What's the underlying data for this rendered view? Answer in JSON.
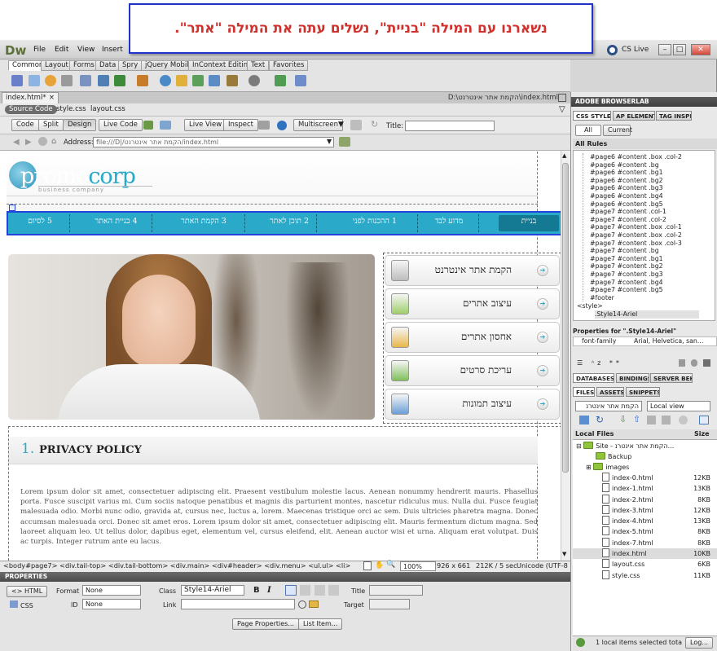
{
  "callout": {
    "text": "נשארנו עם המילה \"בניית\", נשלים עתה את המילה \"אתר\"."
  },
  "app": {
    "logo": "Dw",
    "menu": [
      "File",
      "Edit",
      "View",
      "Insert"
    ],
    "cslive": "CS Live",
    "insert_tabs": [
      "Common",
      "Layout",
      "Forms",
      "Data",
      "Spry",
      "jQuery Mobile",
      "InContext Editing",
      "Text",
      "Favorites"
    ]
  },
  "document": {
    "tab": "index.html*",
    "path": "D:\\הקמת אתר אינטרנט\\index.html",
    "related": [
      "Source Code",
      "style.css",
      "layout.css"
    ],
    "views": [
      "Code",
      "Split",
      "Design"
    ],
    "live_code": "Live Code",
    "live_view": "Live View",
    "inspect": "Inspect",
    "multiscreen": "Multiscreen",
    "title_label": "Title:",
    "title_value": "",
    "address_label": "Address:",
    "address_value": "file:///D|/הקמת אתר אינטרנט/index.html"
  },
  "site": {
    "logo_promo": "promo",
    "logo_corp": "corp",
    "logo_sub": "business company",
    "nav": [
      "בניית",
      "מדוע לבד",
      "1 ההכנות לפני",
      "2 תוכן לאתר",
      "3 הקמת האתר",
      "4 בניית האתר",
      "5 לסיום"
    ],
    "services": [
      "הקמת אתר אינטרנט",
      "עיצוב אתרים",
      "אחסון אתרים",
      "עריכת סרטים",
      "עיצוב תמונות"
    ],
    "policy_num": "1.",
    "policy_title": "PRIVACY POLICY",
    "lorem": "Lorem ipsum dolor sit amet, consectetuer adipiscing elit. Praesent vestibulum molestie lacus. Aenean nonummy hendrerit mauris. Phasellus porta. Fusce suscipit varius mi. Cum sociis natoque penatibus et magnis dis parturient montes, nascetur ridiculus mus. Nulla dui. Fusce feugiat malesuada odio. Morbi nunc odio, gravida at, cursus nec, luctus a, lorem. Maecenas tristique orci ac sem. Duis ultricies pharetra magna. Donec accumsan malesuada orci. Donec sit amet eros. Lorem ipsum dolor sit amet, consectetuer adipiscing elit. Mauris fermentum dictum magna. Sed laoreet aliquam leo. Ut tellus dolor, dapibus eget, elementum vel, cursus eleifend, elit. Aenean auctor wisi et urna. Aliquam erat volutpat. Duis ac turpis. Integer rutrum ante eu lacus."
  },
  "statusbar": {
    "tags": "<body#page7> <div.tail-top> <div.tail-bottom> <div.main> <div#header> <div.menu> <ul.ul> <li>",
    "zoom": "100%",
    "size": "926 x 661",
    "weight": "212K / 5 sec",
    "encoding": "Unicode (UTF-8"
  },
  "properties": {
    "header": "PROPERTIES",
    "html_btn": "HTML",
    "css_btn": "CSS",
    "format_label": "Format",
    "format_value": "None",
    "id_label": "ID",
    "id_value": "None",
    "class_label": "Class",
    "class_value": "Style14-Ariel",
    "link_label": "Link",
    "title_label": "Title",
    "target_label": "Target",
    "bold": "B",
    "italic": "I",
    "page_props": "Page Properties...",
    "list_item": "List Item..."
  },
  "panels": {
    "browserlab": "ADOBE BROWSERLAB",
    "css_tabs": [
      "CSS STYLES",
      "AP ELEMENT",
      "TAG INSPEC"
    ],
    "all": "All",
    "current": "Current",
    "all_rules": "All Rules",
    "rules": [
      "#page6 #content .box .col-2",
      "#page6 #content .bg",
      "#page6 #content .bg1",
      "#page6 #content .bg2",
      "#page6 #content .bg3",
      "#page6 #content .bg4",
      "#page6 #content .bg5",
      "#page7 #content .col-1",
      "#page7 #content .col-2",
      "#page7 #content .box .col-1",
      "#page7 #content .box .col-2",
      "#page7 #content .box .col-3",
      "#page7 #content .bg",
      "#page7 #content .bg1",
      "#page7 #content .bg2",
      "#page7 #content .bg3",
      "#page7 #content .bg4",
      "#page7 #content .bg5",
      "#footer"
    ],
    "style_tag": "<style>",
    "style_rule": ".Style14-Ariel",
    "props_title": "Properties for \".Style14-Ariel\"",
    "font_family_label": "font-family",
    "font_family_value": "Arial, Helvetica, san...",
    "db_tabs": [
      "DATABASES",
      "BINDINGS",
      "SERVER BEHA"
    ],
    "files_tabs": [
      "FILES",
      "ASSETS",
      "SNIPPETS"
    ],
    "site_select": "הקמת אתר אינטרנ",
    "view_select": "Local view",
    "local_files": "Local Files",
    "size_col": "Size",
    "site_root": "Site - הקמת אתר אינטרנ...",
    "folders": [
      "Backup",
      "images"
    ],
    "files": [
      {
        "name": "index-0.html",
        "size": "12KB"
      },
      {
        "name": "index-1.html",
        "size": "13KB"
      },
      {
        "name": "index-2.html",
        "size": "8KB"
      },
      {
        "name": "index-3.html",
        "size": "12KB"
      },
      {
        "name": "index-4.html",
        "size": "13KB"
      },
      {
        "name": "index-5.html",
        "size": "8KB"
      },
      {
        "name": "index-7.html",
        "size": "8KB"
      },
      {
        "name": "index.html",
        "size": "10KB"
      },
      {
        "name": "layout.css",
        "size": "6KB"
      },
      {
        "name": "style.css",
        "size": "11KB"
      }
    ],
    "footer": "1 local items selected tota",
    "log": "Log..."
  },
  "colors": {
    "nav": "#2aa9c8",
    "accent": "#2244dd",
    "callout_text": "#d0312d",
    "logo_blue": "#2aa9c8"
  }
}
